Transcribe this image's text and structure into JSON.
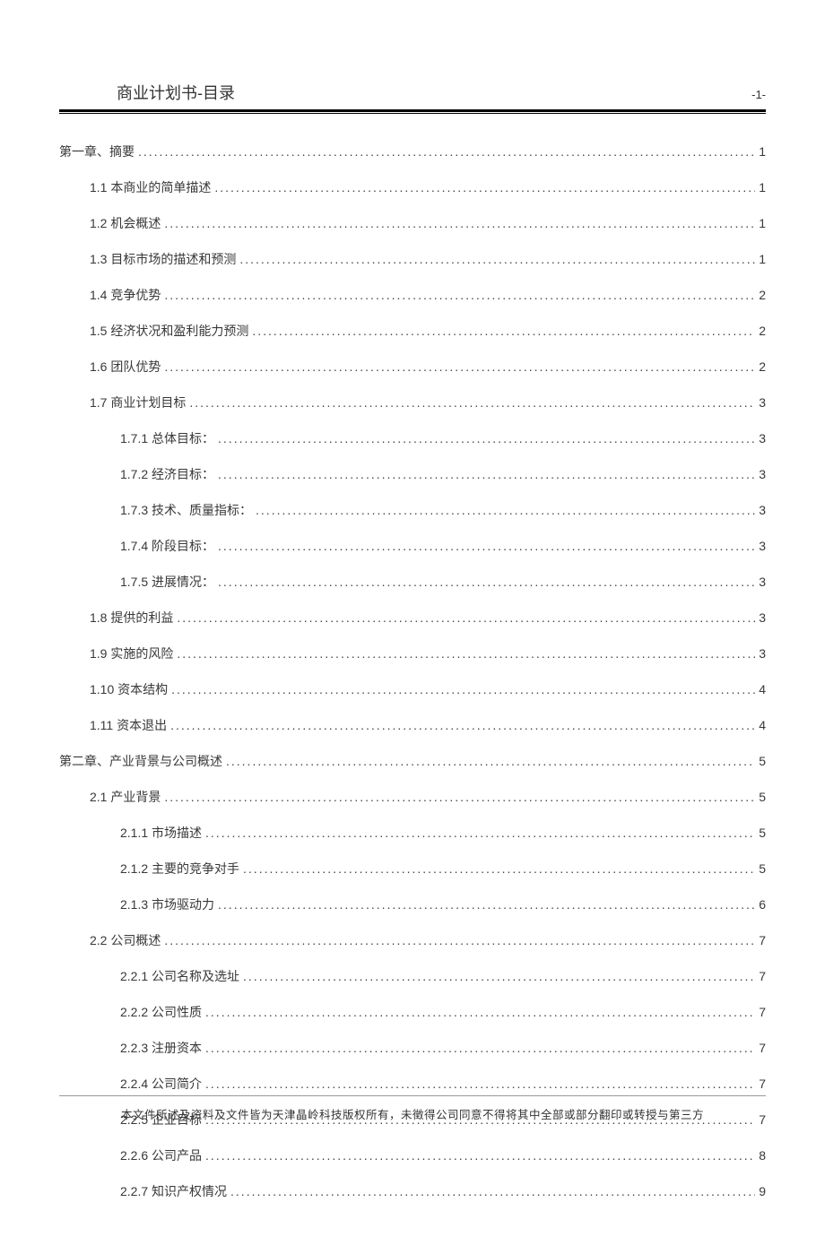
{
  "header": {
    "title": "商业计划书-目录",
    "page_label": "-1-"
  },
  "toc": [
    {
      "level": 0,
      "label": "第一章、摘要",
      "page": "1"
    },
    {
      "level": 1,
      "label": "1.1 本商业的简单描述",
      "page": "1"
    },
    {
      "level": 1,
      "label": "1.2 机会概述",
      "page": "1"
    },
    {
      "level": 1,
      "label": "1.3 目标市场的描述和预测",
      "page": "1"
    },
    {
      "level": 1,
      "label": "1.4 竞争优势",
      "page": "2"
    },
    {
      "level": 1,
      "label": "1.5 经济状况和盈利能力预测",
      "page": "2"
    },
    {
      "level": 1,
      "label": "1.6 团队优势",
      "page": "2"
    },
    {
      "level": 1,
      "label": "1.7 商业计划目标",
      "page": "3"
    },
    {
      "level": 2,
      "label": "1.7.1 总体目标：",
      "page": "3"
    },
    {
      "level": 2,
      "label": "1.7.2 经济目标：",
      "page": "3"
    },
    {
      "level": 2,
      "label": "1.7.3 技术、质量指标：",
      "page": "3"
    },
    {
      "level": 2,
      "label": "1.7.4 阶段目标：",
      "page": "3"
    },
    {
      "level": 2,
      "label": "1.7.5 进展情况：",
      "page": "3"
    },
    {
      "level": 1,
      "label": "1.8 提供的利益",
      "page": "3"
    },
    {
      "level": 1,
      "label": "1.9 实施的风险",
      "page": "3"
    },
    {
      "level": 1,
      "label": "1.10 资本结构",
      "page": "4"
    },
    {
      "level": 1,
      "label": "1.11 资本退出",
      "page": "4"
    },
    {
      "level": 0,
      "label": "第二章、产业背景与公司概述",
      "page": "5"
    },
    {
      "level": 1,
      "label": "2.1 产业背景",
      "page": "5"
    },
    {
      "level": 2,
      "label": "2.1.1 市场描述",
      "page": "5"
    },
    {
      "level": 2,
      "label": "2.1.2 主要的竞争对手",
      "page": "5"
    },
    {
      "level": 2,
      "label": "2.1.3 市场驱动力",
      "page": "6"
    },
    {
      "level": 1,
      "label": "2.2 公司概述",
      "page": "7"
    },
    {
      "level": 2,
      "label": "2.2.1 公司名称及选址",
      "page": "7"
    },
    {
      "level": 2,
      "label": "2.2.2 公司性质",
      "page": "7"
    },
    {
      "level": 2,
      "label": "2.2.3 注册资本",
      "page": "7"
    },
    {
      "level": 2,
      "label": "2.2.4 公司简介",
      "page": "7"
    },
    {
      "level": 2,
      "label": "2.2.5 企业目标",
      "page": "7"
    },
    {
      "level": 2,
      "label": "2.2.6 公司产品",
      "page": "8"
    },
    {
      "level": 2,
      "label": "2.2.7 知识产权情况",
      "page": "9"
    }
  ],
  "footer": {
    "text": "本文件所述及资料及文件皆为天津晶岭科技版权所有，未徵得公司同意不得将其中全部或部分翻印或转授与第三方"
  }
}
